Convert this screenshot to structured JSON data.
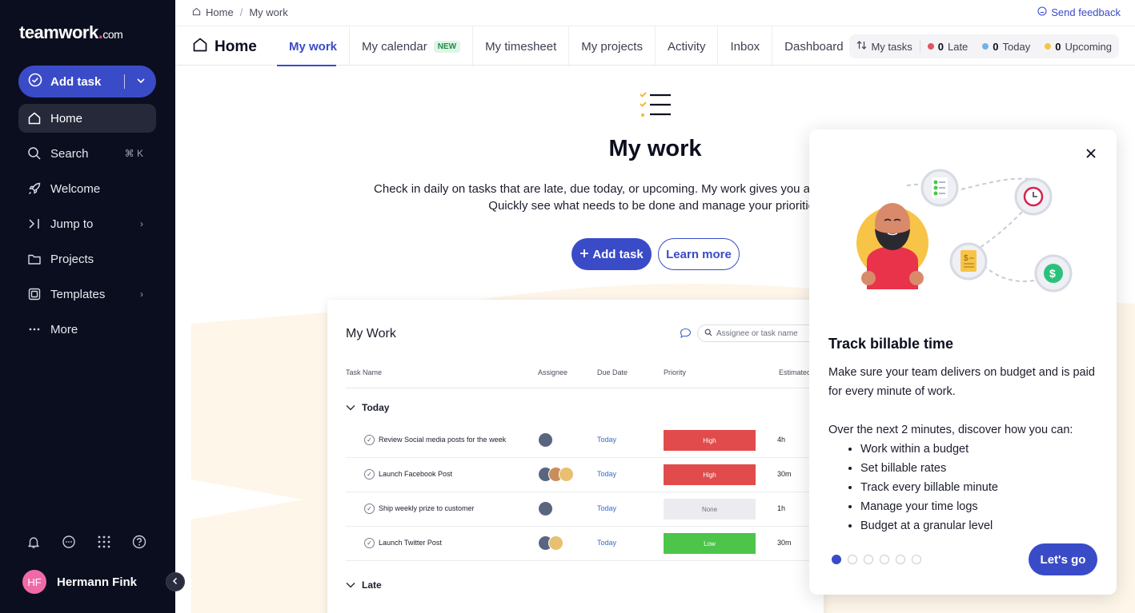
{
  "brand": {
    "name": "teamwork",
    "dot": ".",
    "suffix": "com"
  },
  "sidebar": {
    "add_task_label": "Add task",
    "items": [
      {
        "label": "Home",
        "icon": "home-icon"
      },
      {
        "label": "Search",
        "icon": "search-icon",
        "shortcut": "⌘ K"
      },
      {
        "label": "Welcome",
        "icon": "rocket-icon"
      },
      {
        "label": "Jump to",
        "icon": "jump-icon",
        "chevron": "›"
      },
      {
        "label": "Projects",
        "icon": "folder-icon"
      },
      {
        "label": "Templates",
        "icon": "templates-icon",
        "chevron": "›"
      },
      {
        "label": "More",
        "icon": "more-icon"
      }
    ],
    "user": {
      "initials": "HF",
      "name": "Hermann Fink"
    }
  },
  "breadcrumb": {
    "home": "Home",
    "separator": "/",
    "current": "My work"
  },
  "feedback_label": "Send feedback",
  "header": {
    "title": "Home",
    "tabs": [
      {
        "label": "My work"
      },
      {
        "label": "My calendar",
        "badge": "NEW"
      },
      {
        "label": "My timesheet"
      },
      {
        "label": "My projects"
      },
      {
        "label": "Activity"
      },
      {
        "label": "Inbox"
      },
      {
        "label": "Dashboard"
      }
    ],
    "status": {
      "filter_label": "My tasks",
      "late_count": "0",
      "late_label": "Late",
      "today_count": "0",
      "today_label": "Today",
      "upcoming_count": "0",
      "upcoming_label": "Upcoming"
    }
  },
  "main": {
    "title": "My work",
    "description": "Check in daily on tasks that are late, due today, or upcoming. My work gives you an overview in one place. Quickly see what needs to be done and manage your priorities.",
    "add_task_label": "Add task",
    "learn_more_label": "Learn more"
  },
  "preview": {
    "title": "My Work",
    "search_placeholder": "Assignee or task name",
    "columns": [
      "Task Name",
      "Assignee",
      "Due Date",
      "Priority",
      "Estimated"
    ],
    "groups": [
      {
        "label": "Today",
        "rows": [
          {
            "task": "Review Social media posts for the week",
            "due": "Today",
            "priority": "High",
            "estimate": "4h"
          },
          {
            "task": "Launch Facebook Post",
            "due": "Today",
            "priority": "High",
            "estimate": "30m"
          },
          {
            "task": "Ship weekly prize to customer",
            "due": "Today",
            "priority": "None",
            "estimate": "1h"
          },
          {
            "task": "Launch Twitter Post",
            "due": "Today",
            "priority": "Low",
            "estimate": "30m"
          }
        ]
      },
      {
        "label": "Late",
        "rows": []
      }
    ]
  },
  "tour": {
    "title": "Track billable time",
    "intro": "Make sure your team delivers on budget and is paid for every minute of work.",
    "lead": "Over the next 2 minutes, discover how you can:",
    "bullets": [
      "Work within a budget",
      "Set billable rates",
      "Track every billable minute",
      "Manage your time logs",
      "Budget at a granular level"
    ],
    "cta_label": "Let's go",
    "step_current": 1,
    "step_total": 6
  },
  "colors": {
    "sidebar_bg": "#0b0e1f",
    "accent": "#3a4bc8",
    "late": "#e3545f",
    "today": "#6fb3e8",
    "upcoming": "#f5c542",
    "priority_high": "#e14b4b",
    "priority_low": "#4cc54a",
    "priority_none": "#ececf0"
  }
}
